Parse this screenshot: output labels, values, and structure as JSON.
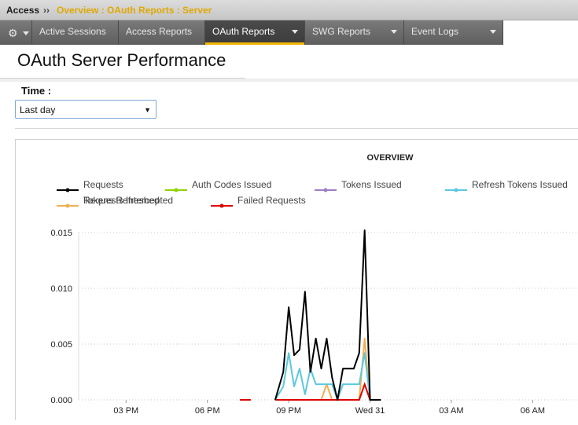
{
  "breadcrumb": {
    "app": "Access",
    "separator": "››",
    "path": "Overview : OAuth Reports : Server"
  },
  "nav": {
    "gear_icon": "gear-icon",
    "tabs": [
      {
        "label": "Active Sessions",
        "has_menu": false,
        "active": false
      },
      {
        "label": "Access Reports",
        "has_menu": false,
        "active": false
      },
      {
        "label": "OAuth Reports",
        "has_menu": true,
        "active": true
      },
      {
        "label": "SWG Reports",
        "has_menu": true,
        "active": false
      },
      {
        "label": "Event Logs",
        "has_menu": true,
        "active": false
      }
    ]
  },
  "page": {
    "title": "OAuth Server Performance",
    "time_label": "Time :",
    "time_value": "Last day"
  },
  "colors": {
    "accent": "#f2b600",
    "nav_bg": "#5c5c5c"
  },
  "chart_data": {
    "type": "line",
    "title": "OVERVIEW",
    "legend_position": "top",
    "grid": true,
    "ylim": [
      0,
      0.015
    ],
    "y_ticks": [
      "0.000",
      "0.005",
      "0.010",
      "0.015"
    ],
    "x_ticks": [
      "03 PM",
      "06 PM",
      "09 PM",
      "Wed 31",
      "03 AM",
      "06 AM"
    ],
    "x_tick_hours": [
      15,
      18,
      21,
      24,
      27,
      30
    ],
    "series": [
      {
        "name": "Requests",
        "color": "#000000",
        "x": [
          20.5,
          20.8,
          21.0,
          21.2,
          21.4,
          21.6,
          21.8,
          22.0,
          22.2,
          22.4,
          22.6,
          22.8,
          23.0,
          23.2,
          23.4,
          23.6,
          23.8,
          24.0,
          24.2,
          24.4
        ],
        "y": [
          0,
          0.0025,
          0.0083,
          0.004,
          0.0045,
          0.0097,
          0.0025,
          0.0055,
          0.0028,
          0.0055,
          0.002,
          0,
          0.0028,
          0.0028,
          0.0028,
          0.0042,
          0.0152,
          0,
          0,
          0
        ]
      },
      {
        "name": "Auth Codes Issued",
        "color": "#8fd400",
        "x": [],
        "y": []
      },
      {
        "name": "Tokens Issued",
        "color": "#a07cc5",
        "x": [],
        "y": []
      },
      {
        "name": "Refresh Tokens Issued",
        "color": "#5bc8e0",
        "x": [
          20.5,
          20.8,
          21.0,
          21.2,
          21.4,
          21.6,
          21.8,
          22.0,
          22.2,
          22.4,
          22.6,
          22.8,
          23.0,
          23.2,
          23.4,
          23.6,
          23.8,
          24.0,
          24.2
        ],
        "y": [
          0,
          0.0012,
          0.0042,
          0.0012,
          0.0028,
          0.0005,
          0.0028,
          0.0014,
          0.0014,
          0.0014,
          0.0014,
          0,
          0.0014,
          0.0014,
          0.0014,
          0.0014,
          0.0042,
          0,
          0
        ]
      },
      {
        "name": "Requests Intercepted",
        "color": "#f0b050",
        "x": [
          20.5,
          22.0,
          22.2,
          22.4,
          22.6,
          22.8,
          23.0,
          23.6,
          23.8,
          24.0,
          24.2
        ],
        "y": [
          0,
          0,
          0,
          0.0014,
          0,
          0,
          0,
          0,
          0.0055,
          0,
          0
        ]
      },
      {
        "name": "Failed Requests",
        "color": "#e00000",
        "x": [
          19.2,
          24.2,
          23.6,
          23.8,
          24.0
        ],
        "y": [
          0,
          0,
          0,
          0.0014,
          0
        ]
      }
    ],
    "legend_row2_overlap_label": "Tokens Refreshed"
  }
}
